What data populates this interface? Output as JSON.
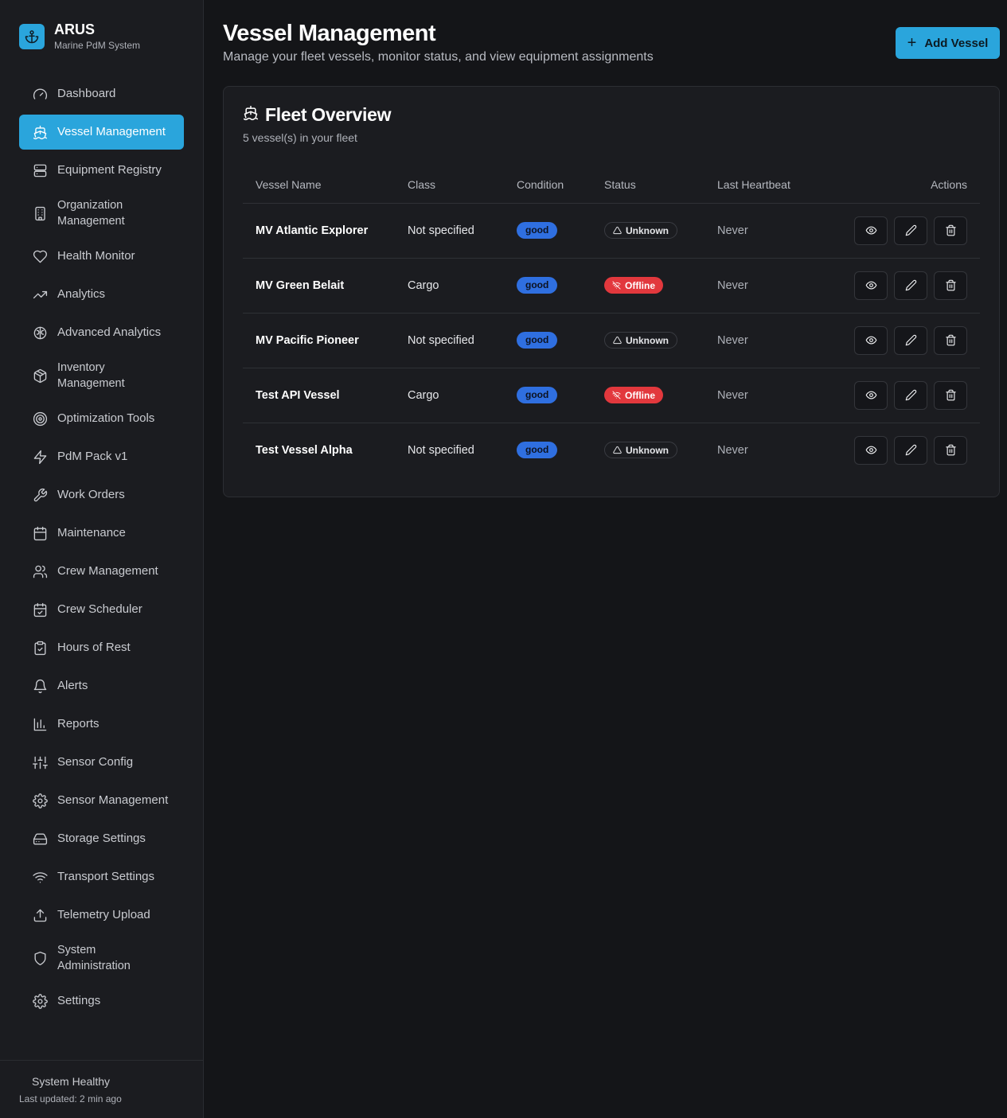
{
  "app": {
    "name": "ARUS",
    "subtitle": "Marine PdM System",
    "logo_icon": "anchor-icon"
  },
  "colors": {
    "accent": "#2aa5dc",
    "good_badge": "#2f6fe0",
    "offline_badge": "#e2383d",
    "background": "#141518",
    "sidebar": "#1b1c20"
  },
  "sidebar": {
    "items": [
      {
        "label": "Dashboard",
        "icon": "gauge-icon"
      },
      {
        "label": "Vessel Management",
        "icon": "ship-icon",
        "active": true
      },
      {
        "label": "Equipment Registry",
        "icon": "server-icon"
      },
      {
        "label": "Organization Management",
        "icon": "building-icon"
      },
      {
        "label": "Health Monitor",
        "icon": "heart-icon"
      },
      {
        "label": "Analytics",
        "icon": "trending-up-icon"
      },
      {
        "label": "Advanced Analytics",
        "icon": "brain-icon"
      },
      {
        "label": "Inventory Management",
        "icon": "package-icon"
      },
      {
        "label": "Optimization Tools",
        "icon": "target-icon"
      },
      {
        "label": "PdM Pack v1",
        "icon": "zap-icon"
      },
      {
        "label": "Work Orders",
        "icon": "wrench-icon"
      },
      {
        "label": "Maintenance",
        "icon": "calendar-icon"
      },
      {
        "label": "Crew Management",
        "icon": "users-icon"
      },
      {
        "label": "Crew Scheduler",
        "icon": "calendar-check-icon"
      },
      {
        "label": "Hours of Rest",
        "icon": "clipboard-check-icon"
      },
      {
        "label": "Alerts",
        "icon": "bell-icon"
      },
      {
        "label": "Reports",
        "icon": "bar-chart-icon"
      },
      {
        "label": "Sensor Config",
        "icon": "sliders-icon"
      },
      {
        "label": "Sensor Management",
        "icon": "cog-icon"
      },
      {
        "label": "Storage Settings",
        "icon": "hard-drive-icon"
      },
      {
        "label": "Transport Settings",
        "icon": "wifi-icon"
      },
      {
        "label": "Telemetry Upload",
        "icon": "upload-icon"
      },
      {
        "label": "System Administration",
        "icon": "shield-icon"
      },
      {
        "label": "Settings",
        "icon": "settings-icon"
      }
    ],
    "footer": {
      "status": "System Healthy",
      "updated": "Last updated: 2 min ago"
    }
  },
  "header": {
    "title": "Vessel Management",
    "subtitle": "Manage your fleet vessels, monitor status, and view equipment assignments",
    "add_button": "Add Vessel"
  },
  "fleet": {
    "title": "Fleet Overview",
    "count_text": "5 vessel(s) in your fleet",
    "columns": [
      "Vessel Name",
      "Class",
      "Condition",
      "Status",
      "Last Heartbeat",
      "Actions"
    ],
    "rows": [
      {
        "name": "MV Atlantic Explorer",
        "class": "Not specified",
        "condition": "good",
        "status": "Unknown",
        "status_type": "unknown",
        "heartbeat": "Never"
      },
      {
        "name": "MV Green Belait",
        "class": "Cargo",
        "condition": "good",
        "status": "Offline",
        "status_type": "offline",
        "heartbeat": "Never"
      },
      {
        "name": "MV Pacific Pioneer",
        "class": "Not specified",
        "condition": "good",
        "status": "Unknown",
        "status_type": "unknown",
        "heartbeat": "Never"
      },
      {
        "name": "Test API Vessel",
        "class": "Cargo",
        "condition": "good",
        "status": "Offline",
        "status_type": "offline",
        "heartbeat": "Never"
      },
      {
        "name": "Test Vessel Alpha",
        "class": "Not specified",
        "condition": "good",
        "status": "Unknown",
        "status_type": "unknown",
        "heartbeat": "Never"
      }
    ],
    "row_actions": [
      "view",
      "edit",
      "delete"
    ]
  }
}
